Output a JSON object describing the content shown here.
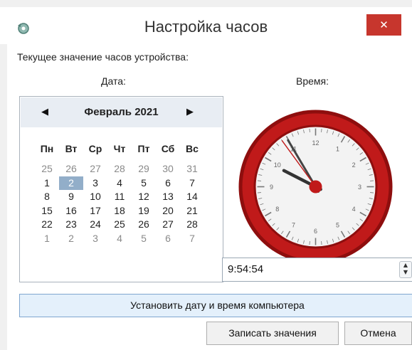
{
  "window": {
    "title": "Настройка часов",
    "close_glyph": "✕",
    "app_icon": "refresh-gear-icon"
  },
  "labels": {
    "current": "Текущее значение часов устройства:",
    "date": "Дата:",
    "time": "Время:"
  },
  "calendar": {
    "month_title": "Февраль 2021",
    "prev_glyph": "◀",
    "next_glyph": "▶",
    "weekdays": [
      "Пн",
      "Вт",
      "Ср",
      "Чт",
      "Пт",
      "Сб",
      "Вс"
    ],
    "weeks": [
      [
        "25",
        "26",
        "27",
        "28",
        "29",
        "30",
        "31"
      ],
      [
        "1",
        "2",
        "3",
        "4",
        "5",
        "6",
        "7"
      ],
      [
        "8",
        "9",
        "10",
        "11",
        "12",
        "13",
        "14"
      ],
      [
        "15",
        "16",
        "17",
        "18",
        "19",
        "20",
        "21"
      ],
      [
        "22",
        "23",
        "24",
        "25",
        "26",
        "27",
        "28"
      ],
      [
        "1",
        "2",
        "3",
        "4",
        "5",
        "6",
        "7"
      ]
    ],
    "selected_day": "2"
  },
  "clock": {
    "hour": 9,
    "minute": 54,
    "second": 54,
    "numerals": [
      "12",
      "1",
      "2",
      "3",
      "4",
      "5",
      "6",
      "7",
      "8",
      "9",
      "10",
      "11"
    ],
    "rim_color": "#c01a1a",
    "hand_color": "#c01a1a"
  },
  "time_input": {
    "value": "9:54:54"
  },
  "buttons": {
    "sync": "Установить дату и время компьютера",
    "save": "Записать значения",
    "cancel": "Отмена"
  }
}
